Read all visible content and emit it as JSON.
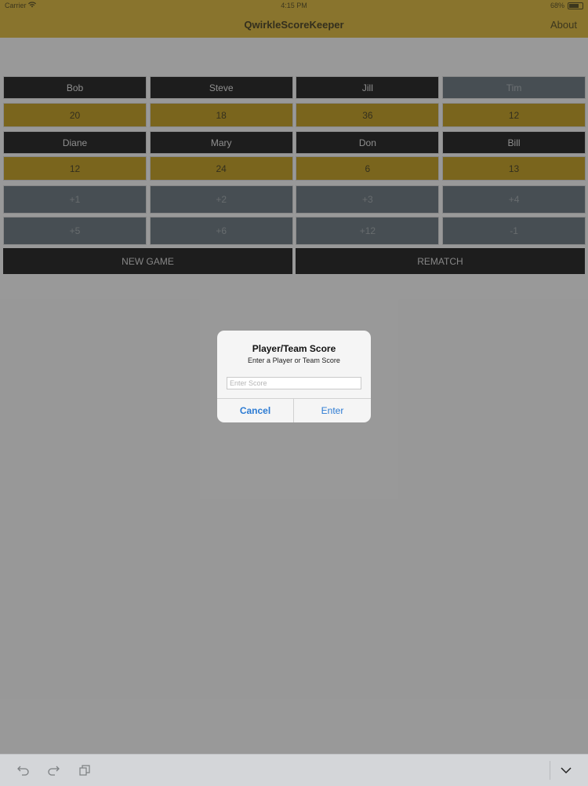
{
  "status_bar": {
    "carrier": "Carrier",
    "time": "4:15 PM",
    "battery": "68%"
  },
  "nav": {
    "title": "QwirkleScoreKeeper",
    "about": "About"
  },
  "players_row1": [
    {
      "name": "Bob",
      "score": "20"
    },
    {
      "name": "Steve",
      "score": "18"
    },
    {
      "name": "Jill",
      "score": "36"
    },
    {
      "name": "Tim",
      "score": "12"
    }
  ],
  "players_row2": [
    {
      "name": "Diane",
      "score": "12"
    },
    {
      "name": "Mary",
      "score": "24"
    },
    {
      "name": "Don",
      "score": "6"
    },
    {
      "name": "Bill",
      "score": "13"
    }
  ],
  "increments_row1": [
    "+1",
    "+2",
    "+3",
    "+4"
  ],
  "increments_row2": [
    "+5",
    "+6",
    "+12",
    "-1"
  ],
  "actions": {
    "new_game": "NEW GAME",
    "rematch": "REMATCH"
  },
  "dialog": {
    "title": "Player/Team Score",
    "message": "Enter a Player or Team Score",
    "input_value": "",
    "input_placeholder": "Enter Score",
    "cancel": "Cancel",
    "enter": "Enter"
  },
  "toolbar_icons": [
    "undo-icon",
    "redo-icon",
    "copy-icon",
    "chevron-down-icon"
  ],
  "colors": {
    "accent_yellow": "#cfa71f",
    "score_gold": "#b28b00",
    "slate": "#515f68",
    "link_blue": "#2c7bd3"
  }
}
